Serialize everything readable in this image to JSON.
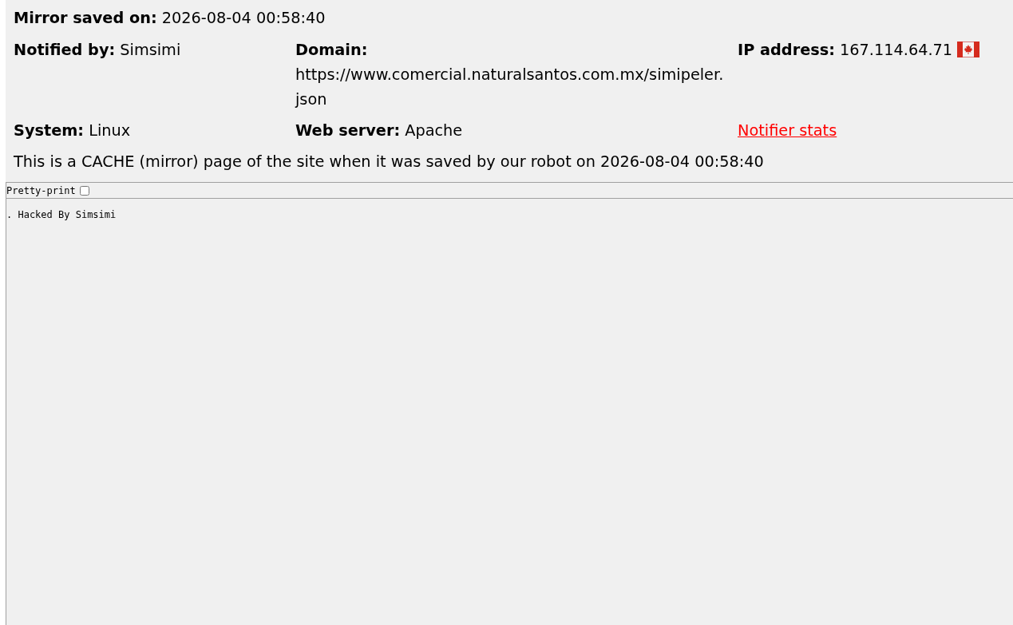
{
  "header": {
    "label": "Mirror saved on:",
    "value": "2026-08-04 00:58:40"
  },
  "details": [
    {
      "kind": "inline",
      "label": "Notified by:",
      "value": "Simsimi"
    },
    {
      "kind": "block",
      "label": "Domain:",
      "value": "https://www.comercial.naturalsantos.com.mx/simipeler.json"
    },
    {
      "kind": "flag",
      "label": "IP address:",
      "value": "167.114.64.71"
    },
    {
      "kind": "inline",
      "label": "System:",
      "value": "Linux"
    },
    {
      "kind": "inline",
      "label": "Web server:",
      "value": "Apache"
    },
    {
      "kind": "link",
      "label": "Notifier stats"
    }
  ],
  "notice": "This is a CACHE (mirror) page of the site when it was saved by our robot on 2026-08-04 00:58:40",
  "frame": {
    "pretty_print": {
      "label": "Pretty-print",
      "checked": false
    },
    "content": ". Hacked By Simsimi"
  }
}
